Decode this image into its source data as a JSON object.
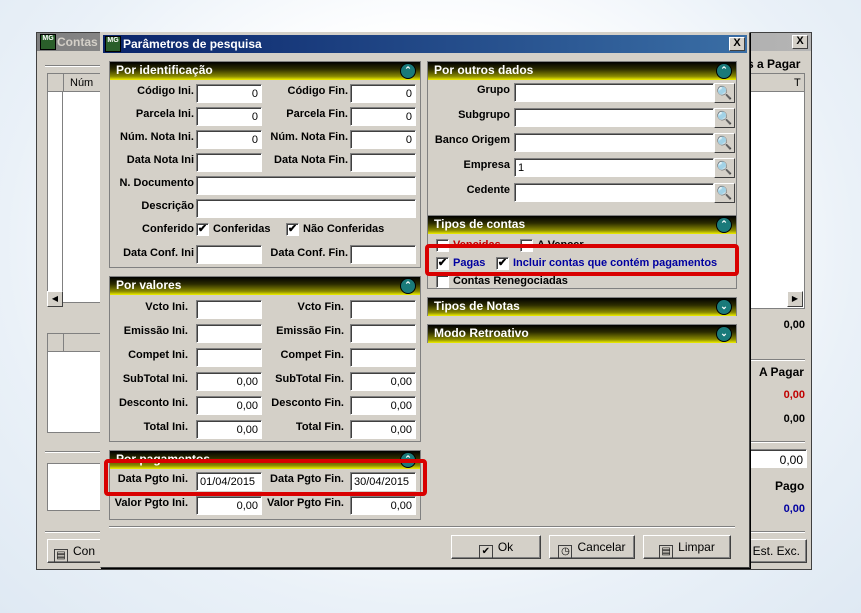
{
  "back_window": {
    "title": "Contas",
    "close": "X",
    "grid_col_num": "Núm",
    "grid_col_t": "T",
    "right_heading": "s a Pagar",
    "total_top": "0,00",
    "a_pagar_label": "A Pagar",
    "a_pagar_value": "0,00",
    "a_pagar_value2": "0,00",
    "total_mid": "0,00",
    "pago_label": "Pago",
    "pago_value": "0,00",
    "btn_con": "Con",
    "btn_est_exc": "Est. Exc."
  },
  "dialog": {
    "title": "Parâmetros de pesquisa",
    "close": "X",
    "icon_text": "MG",
    "identificacao": {
      "header": "Por identificação",
      "codigo_ini_label": "Código Ini.",
      "codigo_ini": "0",
      "codigo_fin_label": "Código Fin.",
      "codigo_fin": "0",
      "parcela_ini_label": "Parcela Ini.",
      "parcela_ini": "0",
      "parcela_fin_label": "Parcela Fin.",
      "parcela_fin": "0",
      "num_nota_ini_label": "Núm. Nota Ini.",
      "num_nota_ini": "0",
      "num_nota_fin_label": "Núm. Nota Fin.",
      "num_nota_fin": "0",
      "data_nota_ini_label": "Data Nota Ini",
      "data_nota_fin_label": "Data Nota Fin.",
      "n_documento_label": "N. Documento",
      "descricao_label": "Descrição",
      "conferido_label": "Conferido",
      "conferidas_label": "Conferidas",
      "nao_conferidas_label": "Não Conferidas",
      "data_conf_ini_label": "Data Conf. Ini",
      "data_conf_fin_label": "Data Conf. Fin."
    },
    "valores": {
      "header": "Por valores",
      "vcto_ini_label": "Vcto Ini.",
      "vcto_fin_label": "Vcto Fin.",
      "emissao_ini_label": "Emissão Ini.",
      "emissao_fin_label": "Emissão Fin.",
      "compet_ini_label": "Compet Ini.",
      "compet_fin_label": "Compet Fin.",
      "subtotal_ini_label": "SubTotal Ini.",
      "subtotal_ini": "0,00",
      "subtotal_fin_label": "SubTotal Fin.",
      "subtotal_fin": "0,00",
      "desconto_ini_label": "Desconto Ini.",
      "desconto_ini": "0,00",
      "desconto_fin_label": "Desconto Fin.",
      "desconto_fin": "0,00",
      "total_ini_label": "Total Ini.",
      "total_ini": "0,00",
      "total_fin_label": "Total Fin.",
      "total_fin": "0,00"
    },
    "pagamentos": {
      "header": "Por pagamentos",
      "data_pgto_ini_label": "Data Pgto Ini.",
      "data_pgto_ini": "01/04/2015",
      "data_pgto_fin_label": "Data Pgto Fin.",
      "data_pgto_fin": "30/04/2015",
      "valor_pgto_ini_label": "Valor Pgto Ini.",
      "valor_pgto_ini": "0,00",
      "valor_pgto_fin_label": "Valor Pgto Fin.",
      "valor_pgto_fin": "0,00"
    },
    "outros": {
      "header": "Por outros dados",
      "grupo_label": "Grupo",
      "subgrupo_label": "Subgrupo",
      "banco_origem_label": "Banco Origem",
      "empresa_label": "Empresa",
      "empresa_value": "1",
      "cedente_label": "Cedente"
    },
    "tipos_contas": {
      "header": "Tipos de contas",
      "vencidas_label": "Vencidas",
      "a_vencer_label": "A Vencer",
      "pagas_label": "Pagas",
      "incluir_label": "Incluir contas que contém pagamentos",
      "renegociadas_label": "Contas Renegociadas"
    },
    "tipos_notas_header": "Tipos de Notas",
    "modo_retroativo_header": "Modo Retroativo",
    "ok_label": "Ok",
    "cancelar_label": "Cancelar",
    "limpar_label": "Limpar"
  },
  "colors": {
    "highlight": "#d90000",
    "title_blue": "#0a246a",
    "window_gray": "#d4d0c8",
    "label_blue": "#0000a0",
    "value_red": "#c00000"
  }
}
